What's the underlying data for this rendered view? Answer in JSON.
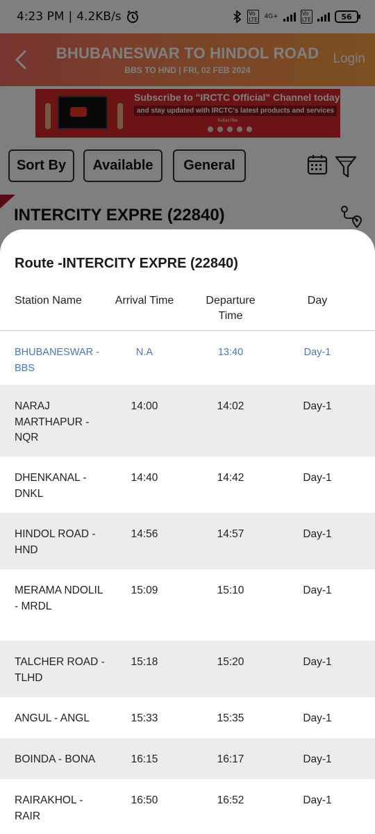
{
  "status_bar": {
    "time": "4:23 PM",
    "speed": "4.2KB/s",
    "net1": "4G+",
    "battery": "56"
  },
  "header": {
    "title": "BHUBANESWAR TO HINDOL ROAD",
    "subtitle": "BBS TO HND | FRI, 02 FEB  2024",
    "login_label": "Login"
  },
  "banner": {
    "line1": "Subscribe to \"IRCTC Official\" Channel today",
    "line2": "and stay updated with IRCTC's latest products and services",
    "cta": "Subscribe"
  },
  "filters": {
    "sort_label": "Sort By",
    "available_label": "Available",
    "general_label": "General"
  },
  "train": {
    "name": "INTERCITY EXPRE (22840)"
  },
  "route": {
    "title": "Route -INTERCITY EXPRE (22840)",
    "columns": {
      "station": "Station Name",
      "arrival": "Arrival Time",
      "departure": "Departure Time",
      "day": "Day"
    },
    "stops": [
      {
        "station": "BHUBANESWAR - BBS",
        "arrival": "N.A",
        "departure": "13:40",
        "day": "Day-1"
      },
      {
        "station": "NARAJ MARTHAPUR - NQR",
        "arrival": "14:00",
        "departure": "14:02",
        "day": "Day-1"
      },
      {
        "station": "DHENKANAL - DNKL",
        "arrival": "14:40",
        "departure": "14:42",
        "day": "Day-1"
      },
      {
        "station": "HINDOL ROAD - HND",
        "arrival": "14:56",
        "departure": "14:57",
        "day": "Day-1"
      },
      {
        "station": "MERAMA NDOLIL - MRDL",
        "arrival": "15:09",
        "departure": "15:10",
        "day": "Day-1"
      },
      {
        "station": "TALCHER ROAD - TLHD",
        "arrival": "15:18",
        "departure": "15:20",
        "day": "Day-1"
      },
      {
        "station": "ANGUL - ANGL",
        "arrival": "15:33",
        "departure": "15:35",
        "day": "Day-1"
      },
      {
        "station": "BOINDA - BONA",
        "arrival": "16:15",
        "departure": "16:17",
        "day": "Day-1"
      },
      {
        "station": "RAIRAKHOL - RAIR",
        "arrival": "16:50",
        "departure": "16:52",
        "day": "Day-1"
      }
    ]
  }
}
